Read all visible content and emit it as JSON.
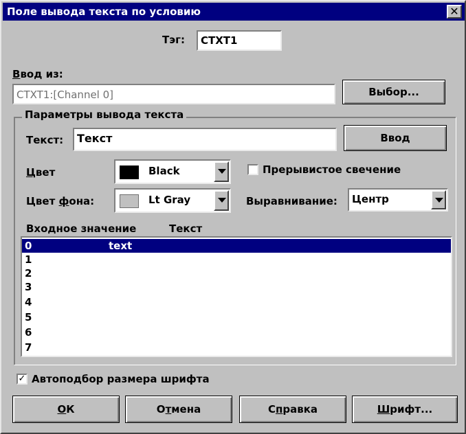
{
  "window": {
    "title": "Поле вывода текста по условию",
    "close_glyph": "✕"
  },
  "tag": {
    "label": "Тэг:",
    "value": "CTXT1"
  },
  "input_from": {
    "label_prefix": "В",
    "label_rest": "вод из:",
    "value": "CTXT1:[Channel 0]",
    "choose_button": "Выбор..."
  },
  "params": {
    "group_title": "Параметры вывода текста",
    "text_label": "Текст:",
    "text_value": "Текст",
    "enter_button": "Ввод",
    "color_label_u": "Ц",
    "color_label_rest": "вет",
    "color_value": "Black",
    "color_swatch": "#000000",
    "bg_label_pre": "Цвет ",
    "bg_label_u": "ф",
    "bg_label_rest": "она:",
    "bg_value": "Lt Gray",
    "bg_swatch": "#c0c0c0",
    "blink_label": "Прерывистое свечение",
    "blink_checked": false,
    "align_label": "Выравнивание:",
    "align_value": "Центр"
  },
  "table": {
    "col_input": "Входное значение",
    "col_text": "Текст",
    "rows": [
      {
        "value": "0",
        "text": "text",
        "selected": true
      },
      {
        "value": "1",
        "text": ""
      },
      {
        "value": "2",
        "text": ""
      },
      {
        "value": "3",
        "text": ""
      },
      {
        "value": "4",
        "text": ""
      },
      {
        "value": "5",
        "text": ""
      },
      {
        "value": "6",
        "text": ""
      },
      {
        "value": "7",
        "text": ""
      }
    ]
  },
  "autofit": {
    "label": "Автоподбор размера шрифта",
    "checked": true,
    "check_glyph": "✓"
  },
  "buttons": {
    "ok_u": "О",
    "ok_rest": "К",
    "cancel_pre": "О",
    "cancel_u": "т",
    "cancel_rest": "мена",
    "help_pre": "С",
    "help_u": "п",
    "help_rest": "равка",
    "font_u": "Ш",
    "font_rest": "рифт..."
  }
}
